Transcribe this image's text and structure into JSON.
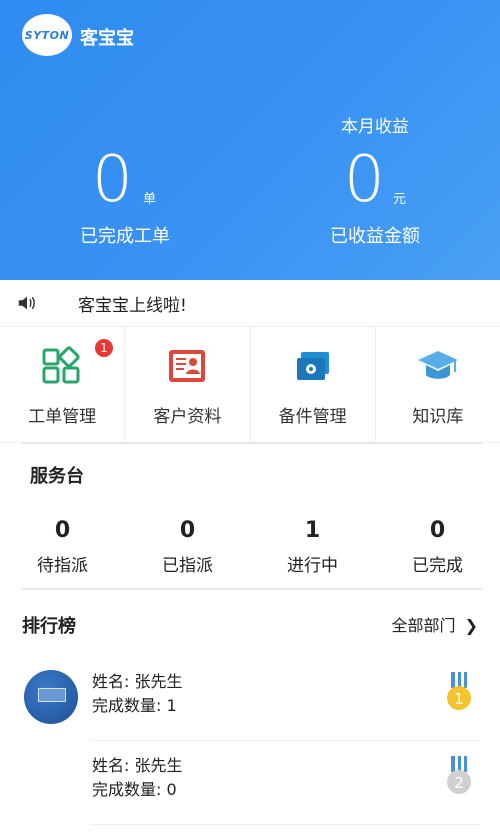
{
  "header": {
    "logo_text": "SYTON",
    "app_title": "客宝宝",
    "completed": {
      "value": "0",
      "unit": "单",
      "label": "已完成工单"
    },
    "earnings": {
      "caption": "本月收益",
      "value": "0",
      "unit": "元",
      "label": "已收益金额"
    },
    "colors": {
      "gradient_start": "#2f8bf0",
      "gradient_end": "#4aa0f5"
    }
  },
  "notice": {
    "icon": "speaker-icon",
    "text": "客宝宝上线啦!"
  },
  "grid": [
    {
      "label": "工单管理",
      "icon": "work-order-icon",
      "badge": "1"
    },
    {
      "label": "客户资料",
      "icon": "customer-profile-icon"
    },
    {
      "label": "备件管理",
      "icon": "spare-parts-icon"
    },
    {
      "label": "知识库",
      "icon": "knowledge-icon"
    }
  ],
  "service_desk": {
    "title": "服务台",
    "items": [
      {
        "value": "0",
        "label": "待指派"
      },
      {
        "value": "0",
        "label": "已指派"
      },
      {
        "value": "1",
        "label": "进行中"
      },
      {
        "value": "0",
        "label": "已完成"
      }
    ]
  },
  "ranking": {
    "title": "排行榜",
    "link": "全部部门",
    "rows": [
      {
        "name_label": "姓名:",
        "name": "张先生",
        "count_label": "完成数量:",
        "count": "1",
        "medal": "1"
      },
      {
        "name_label": "姓名:",
        "name": "张先生",
        "count_label": "完成数量:",
        "count": "0",
        "medal": "2"
      }
    ]
  }
}
